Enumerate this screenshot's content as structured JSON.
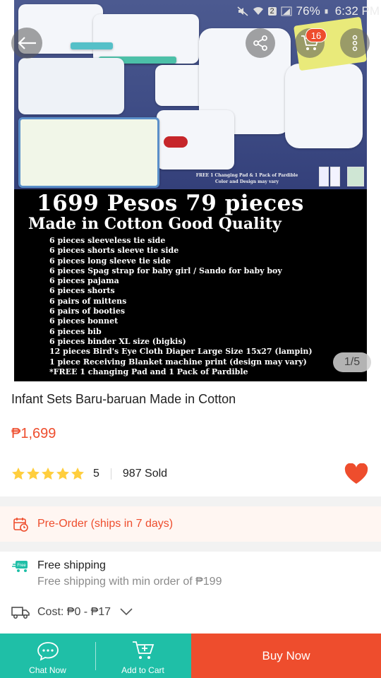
{
  "status_bar": {
    "battery": "76%",
    "time": "6:32 PM",
    "sim_badge": "2"
  },
  "header": {
    "cart_count": "16"
  },
  "gallery": {
    "page_indicator": "1/5",
    "photo_note": "FREE 1 Changing Pad & 1 Pack of Pardible Color and Design may vary",
    "promo_title": "1699 Pesos 79 pieces",
    "promo_subtitle": "Made in Cotton Good Quality",
    "promo_items": [
      "6 pieces sleeveless tie side",
      "6 pieces shorts sleeve tie side",
      "6 pieces long sleeve tie side",
      "6 pieces Spag strap for baby girl / Sando for baby boy",
      "6 pieces pajama",
      "6 pieces shorts",
      "6 pairs of mittens",
      "6 pairs of booties",
      "6 pieces bonnet",
      "6 pieces bib",
      "6 pieces binder XL size (bigkis)",
      "12 pieces Bird's Eye Cloth Diaper Large Size 15x27 (lampin)",
      "1 piece Receiving Blanket machine print (design may vary)",
      "*FREE 1 changing Pad and 1 Pack of Pardible"
    ]
  },
  "product": {
    "title": "Infant Sets Baru-baruan Made in Cotton",
    "price": "₱1,699",
    "rating": "5",
    "rating_stars": 5,
    "sold": "987 Sold"
  },
  "preorder": {
    "label": "Pre-Order (ships in 7 days)"
  },
  "shipping": {
    "badge": "Free",
    "title": "Free shipping",
    "subtitle": "Free shipping with min order of ₱199",
    "cost": "Cost: ₱0 - ₱17"
  },
  "bottom_bar": {
    "chat_label": "Chat Now",
    "cart_label": "Add to Cart",
    "buy_label": "Buy Now"
  },
  "colors": {
    "accent": "#ee4d2d",
    "teal": "#1fbfa7",
    "star": "#ffce3d"
  }
}
